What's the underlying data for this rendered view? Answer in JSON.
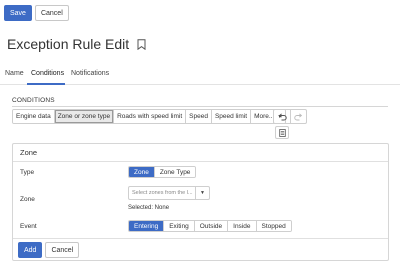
{
  "toolbar": {
    "save_label": "Save",
    "cancel_label": "Cancel"
  },
  "page": {
    "title": "Exception Rule Edit"
  },
  "tabs": [
    {
      "label": "Name"
    },
    {
      "label": "Conditions"
    },
    {
      "label": "Notifications"
    }
  ],
  "conditions": {
    "heading": "CONDITIONS",
    "segments": [
      {
        "label": "Engine data"
      },
      {
        "label": "Zone or zone type"
      },
      {
        "label": "Roads with speed limit"
      },
      {
        "label": "Speed"
      },
      {
        "label": "Speed limit"
      },
      {
        "label": "More..."
      }
    ]
  },
  "zone_panel": {
    "title": "Zone",
    "type_label": "Type",
    "type_options": [
      "Zone",
      "Zone Type"
    ],
    "zone_label": "Zone",
    "zone_placeholder": "Select zones from the l...",
    "selected_text": "Selected: None",
    "event_label": "Event",
    "event_options": [
      "Entering",
      "Exiting",
      "Outside",
      "Inside",
      "Stopped"
    ],
    "add_label": "Add",
    "cancel_label": "Cancel"
  }
}
